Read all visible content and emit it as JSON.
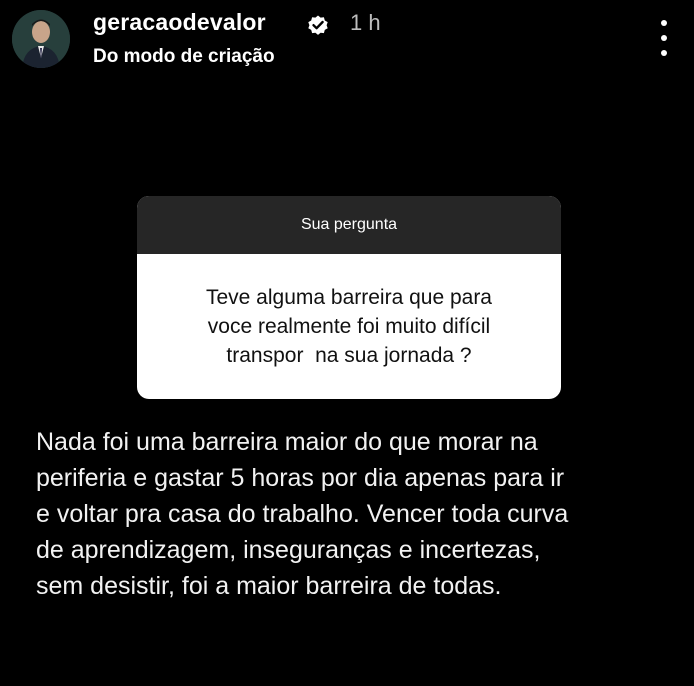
{
  "header": {
    "username": "geracaodevalor",
    "time": "1 h",
    "subtitle": "Do modo de criação",
    "verified_icon": "verified-badge-icon",
    "more_icon": "more-vertical-icon"
  },
  "question_card": {
    "title": "Sua pergunta",
    "lines": [
      "Teve alguma barreira que para",
      "voce realmente foi muito difícil",
      "transpor  na sua jornada ?"
    ]
  },
  "answer": {
    "lines": [
      "Nada foi uma barreira maior do que morar na",
      "periferia e gastar 5 horas por dia apenas para ir",
      "e voltar pra casa do trabalho. Vencer toda curva",
      "de aprendizagem, inseguranças e incertezas,",
      "sem desistir, foi a maior barreira de todas."
    ]
  },
  "colors": {
    "background": "#000000",
    "question_header": "#262626",
    "question_body": "#ffffff",
    "time": "#bdbdbd"
  }
}
